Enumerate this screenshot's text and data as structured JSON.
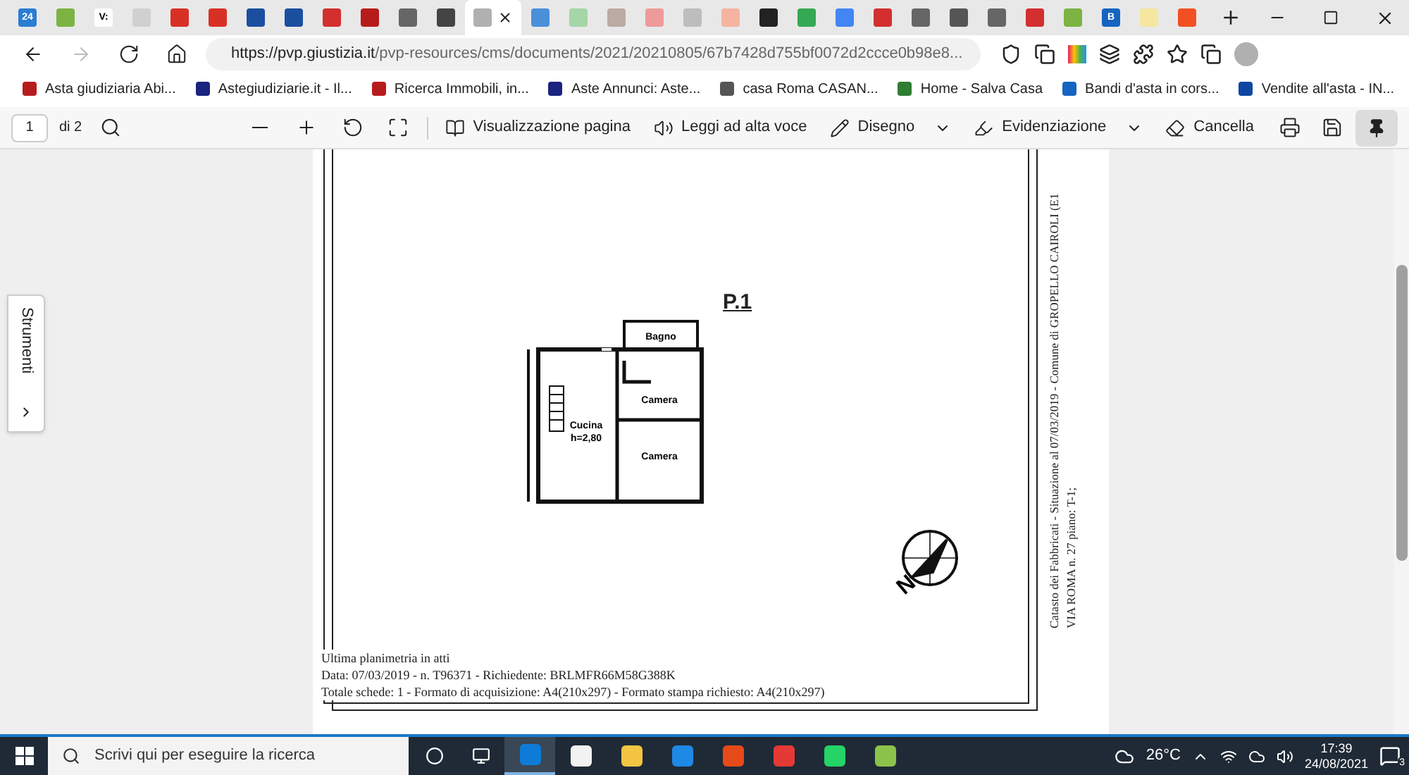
{
  "tabs": [
    {
      "selected": false,
      "color": "#2b7cd3",
      "label": "24"
    },
    {
      "selected": false,
      "color": "#7cb342"
    },
    {
      "selected": false,
      "color": "#ffffff",
      "label": "V:"
    },
    {
      "selected": false,
      "color": "#d0d0d0"
    },
    {
      "selected": false,
      "color": "#d93025"
    },
    {
      "selected": false,
      "color": "#d93025"
    },
    {
      "selected": false,
      "color": "#1a4fa0"
    },
    {
      "selected": false,
      "color": "#1a4fa0"
    },
    {
      "selected": false,
      "color": "#d32f2f"
    },
    {
      "selected": false,
      "color": "#b71c1c"
    },
    {
      "selected": false,
      "color": "#666666"
    },
    {
      "selected": false,
      "color": "#444444"
    },
    {
      "selected": true,
      "color": "#b0b0b0"
    },
    {
      "selected": false,
      "color": "#4a90d9"
    },
    {
      "selected": false,
      "color": "#a5d6a7"
    },
    {
      "selected": false,
      "color": "#bcaaa4"
    },
    {
      "selected": false,
      "color": "#ef9a9a"
    },
    {
      "selected": false,
      "color": "#bdbdbd"
    },
    {
      "selected": false,
      "color": "#f4b4a0"
    },
    {
      "selected": false,
      "color": "#222222"
    },
    {
      "selected": false,
      "color": "#34a853"
    },
    {
      "selected": false,
      "color": "#4285f4"
    },
    {
      "selected": false,
      "color": "#d32f2f"
    },
    {
      "selected": false,
      "color": "#666666"
    },
    {
      "selected": false,
      "color": "#555555"
    },
    {
      "selected": false,
      "color": "#666666"
    },
    {
      "selected": false,
      "color": "#d32f2f"
    },
    {
      "selected": false,
      "color": "#7cb342"
    },
    {
      "selected": false,
      "color": "#1565c0",
      "label": "B"
    },
    {
      "selected": false,
      "color": "#f5e6a0"
    },
    {
      "selected": false,
      "color": "#f25022"
    }
  ],
  "address_bar": {
    "url_host": "https://pvp.giustizia.it",
    "url_path": "/pvp-resources/cms/documents/2021/20210805/67b7428d755bf0072d2ccce0b98e8..."
  },
  "bookmarks": [
    {
      "label": "Asta giudiziaria Abi...",
      "color": "#b71c1c"
    },
    {
      "label": "Astegiudiziarie.it - Il...",
      "color": "#1a237e"
    },
    {
      "label": "Ricerca Immobili, in...",
      "color": "#b71c1c"
    },
    {
      "label": "Aste Annunci: Aste...",
      "color": "#1a237e"
    },
    {
      "label": "casa Roma CASAN...",
      "color": "#555555"
    },
    {
      "label": "Home - Salva Casa",
      "color": "#2e7d32"
    },
    {
      "label": "Bandi d'asta in cors...",
      "color": "#1565c0"
    },
    {
      "label": "Vendite all'asta - IN...",
      "color": "#0d47a1"
    }
  ],
  "pdf_toolbar": {
    "page": "1",
    "page_count": "di 2",
    "pinned": true,
    "items": [
      {
        "kind": "page-view",
        "label": "Visualizzazione pagina",
        "dropdown": false
      },
      {
        "kind": "read-aloud",
        "label": "Leggi ad alta voce",
        "dropdown": false
      },
      {
        "kind": "draw",
        "label": "Disegno",
        "dropdown": true
      },
      {
        "kind": "highlight",
        "label": "Evidenziazione",
        "dropdown": true
      },
      {
        "kind": "erase",
        "label": "Cancella",
        "dropdown": false
      }
    ]
  },
  "side_panel": {
    "label": "Strumenti"
  },
  "document": {
    "title": "P.1",
    "rooms": [
      {
        "label": "Bagno"
      },
      {
        "label": "Camera"
      },
      {
        "label": "Cucina"
      },
      {
        "label": "h=2,80"
      },
      {
        "label": "Camera"
      }
    ],
    "compass_label": "N",
    "footer": [
      "Ultima planimetria in atti",
      "Data: 07/03/2019 - n. T96371 - Richiedente: BRLMFR66M58G388K",
      "Totale schede: 1 - Formato di acquisizione: A4(210x297)  - Formato stampa richiesto: A4(210x297)"
    ],
    "margin_lines": [
      "Catasto dei Fabbricati - Situazione al 07/03/2019 - Comune di GROPELLO CAIROLI (E1",
      "VIA ROMA n. 27 piano: T-1;"
    ]
  },
  "taskbar": {
    "search_placeholder": "Scrivi qui per eseguire la ricerca",
    "apps": [
      {
        "color": "#0f7bd8",
        "selected": true
      },
      {
        "color": "#f2f2f2",
        "selected": false
      },
      {
        "color": "#f4c542",
        "selected": false
      },
      {
        "color": "#1e88e5",
        "selected": false
      },
      {
        "color": "#e64a19",
        "selected": false
      },
      {
        "color": "#e53935",
        "selected": false
      },
      {
        "color": "#25d366",
        "selected": false
      },
      {
        "color": "#8bc34a",
        "selected": false
      }
    ],
    "temperature": "26°C",
    "time": "17:39",
    "date": "24/08/2021",
    "notifications": "3"
  }
}
